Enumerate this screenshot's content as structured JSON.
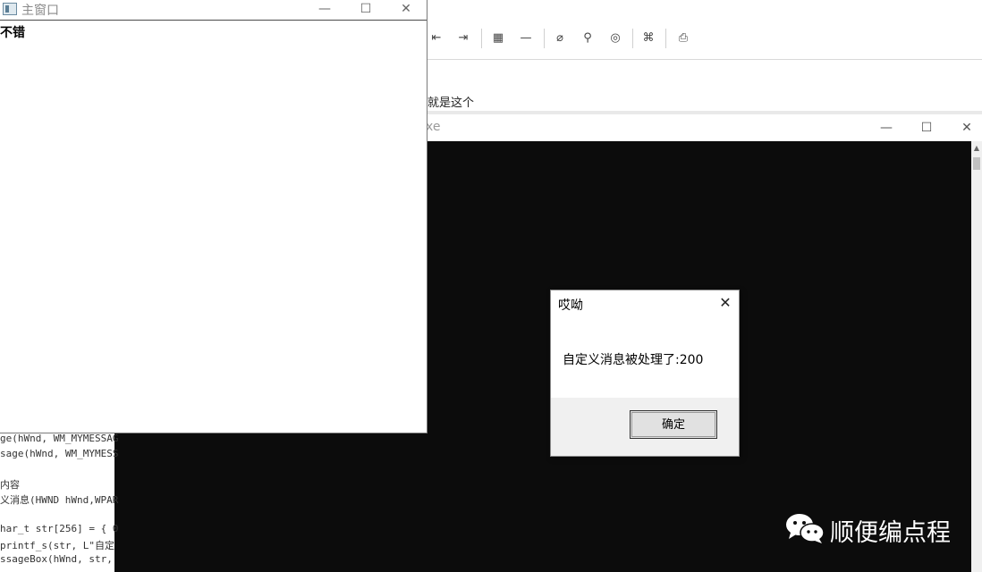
{
  "editor": {
    "body_text": "就是这个",
    "toolbar_icons": [
      "outdent-icon",
      "indent-icon",
      "table-icon",
      "horizontal-rule-icon",
      "attachment-icon",
      "location-pin-icon",
      "emoji-icon",
      "command-icon",
      "print-icon"
    ]
  },
  "console_window": {
    "title": "xe",
    "scroll_up_glyph": "▲"
  },
  "main_window": {
    "title": "主窗口",
    "content_text": "不错"
  },
  "code_snippet": {
    "lines": [
      "ge(hWnd, WM_MYMESSAG",
      "sage(hWnd, WM_MYMESS",
      "",
      "内容",
      "义消息(HWND hWnd,WPAR",
      "",
      "har_t str[256] = { 0",
      "printf_s(str, L\"自定",
      "ssageBox(hWnd, str,"
    ]
  },
  "message_box": {
    "title": "哎呦",
    "message": "自定义消息被处理了:200",
    "ok_label": "确定"
  },
  "window_controls": {
    "minimize": "—",
    "maximize": "☐",
    "close": "✕"
  },
  "watermark": {
    "text": "顺便编点程"
  }
}
